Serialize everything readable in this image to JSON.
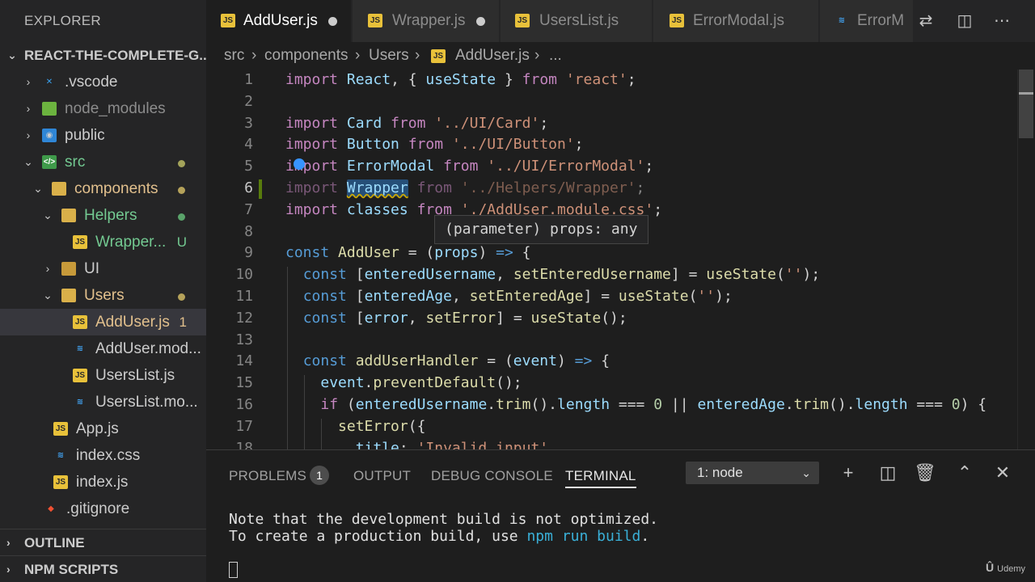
{
  "sidebar": {
    "title": "EXPLORER",
    "root": "REACT-THE-COMPLETE-G...",
    "items": [
      {
        "label": ".vscode",
        "chev": "›",
        "icon": "vscode-folder-icon",
        "color": "#cccccc"
      },
      {
        "label": "node_modules",
        "chev": "›",
        "icon": "node-folder-icon",
        "color": "#8c8c8c"
      },
      {
        "label": "public",
        "chev": "›",
        "icon": "public-folder-icon",
        "color": "#cccccc"
      },
      {
        "label": "src",
        "chev": "⌄",
        "icon": "src-folder-icon",
        "color": "#73c991"
      },
      {
        "label": "components",
        "chev": "⌄",
        "icon": "folder-open-icon",
        "color": "#e2c08d"
      },
      {
        "label": "Helpers",
        "chev": "⌄",
        "icon": "folder-open-icon",
        "color": "#73c991"
      },
      {
        "label": "Wrapper...",
        "badge": "U",
        "icon": "js-file-icon",
        "color": "#73c991"
      },
      {
        "label": "UI",
        "chev": "›",
        "icon": "folder-icon",
        "color": "#cccccc"
      },
      {
        "label": "Users",
        "chev": "⌄",
        "icon": "folder-open-icon",
        "color": "#e2c08d"
      },
      {
        "label": "AddUser.js",
        "badge": "1",
        "icon": "js-file-icon",
        "color": "#e2c08d"
      },
      {
        "label": "AddUser.mod...",
        "icon": "css-file-icon",
        "color": "#cccccc"
      },
      {
        "label": "UsersList.js",
        "icon": "js-file-icon",
        "color": "#cccccc"
      },
      {
        "label": "UsersList.mo...",
        "icon": "css-file-icon",
        "color": "#cccccc"
      },
      {
        "label": "App.js",
        "icon": "js-file-icon",
        "color": "#cccccc"
      },
      {
        "label": "index.css",
        "icon": "css-file-icon",
        "color": "#cccccc"
      },
      {
        "label": "index.js",
        "icon": "js-file-icon",
        "color": "#cccccc"
      },
      {
        "label": ".gitignore",
        "icon": "git-file-icon",
        "color": "#cccccc"
      }
    ],
    "outline": "OUTLINE",
    "npm_scripts": "NPM SCRIPTS"
  },
  "tabs": [
    {
      "label": "AddUser.js",
      "icon": "js",
      "modified": true,
      "active": true
    },
    {
      "label": "Wrapper.js",
      "icon": "js",
      "modified": true,
      "active": false
    },
    {
      "label": "UsersList.js",
      "icon": "js",
      "modified": false,
      "active": false
    },
    {
      "label": "ErrorModal.js",
      "icon": "js",
      "modified": false,
      "active": false
    },
    {
      "label": "ErrorM",
      "icon": "css",
      "modified": false,
      "active": false
    }
  ],
  "breadcrumb": [
    "src",
    "components",
    "Users",
    "AddUser.js",
    "..."
  ],
  "editor": {
    "line_numbers": [
      "1",
      "2",
      "3",
      "4",
      "5",
      "6",
      "7",
      "8",
      "9",
      "10",
      "11",
      "12",
      "13",
      "14",
      "15",
      "16",
      "17",
      "18"
    ],
    "tooltip": "(parameter) props: any"
  },
  "panel": {
    "tabs": [
      "PROBLEMS",
      "OUTPUT",
      "DEBUG CONSOLE",
      "TERMINAL"
    ],
    "problems_count": "1",
    "terminal_select": "1: node",
    "terminal_line1": "Note that the development build is not optimized.",
    "terminal_line2_prefix": "To create a production build, use ",
    "terminal_line2_cmd": "npm run build",
    "terminal_line2_suffix": "."
  },
  "watermark": "Udemy"
}
